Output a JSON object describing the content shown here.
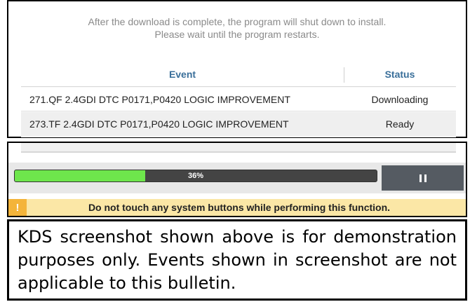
{
  "notice": {
    "line1": "After the download is complete, the program will shut down to install.",
    "line2": "Please wait until the program restarts."
  },
  "table": {
    "headers": {
      "event": "Event",
      "status": "Status"
    },
    "rows": [
      {
        "event": "271.QF 2.4GDI DTC P0171,P0420 LOGIC IMPROVEMENT",
        "status": "Downloading"
      },
      {
        "event": "273.TF 2.4GDI DTC P0171,P0420 LOGIC IMPROVEMENT",
        "status": "Ready"
      }
    ]
  },
  "progress": {
    "percent": 36,
    "label": "36%"
  },
  "pause_icon": "pause-icon",
  "warning": {
    "icon": "!",
    "text": "Do not touch any system buttons while performing this function."
  },
  "disclaimer": "KDS screenshot shown above is for demonstration purposes only. Events shown in screenshot are not applicable to this bulletin.",
  "colors": {
    "progress_fill": "#6ee64c",
    "progress_track": "#444444",
    "warning_bg": "#fbe7a6",
    "warning_icon": "#f4b43a",
    "header_text": "#3a6f9a"
  }
}
